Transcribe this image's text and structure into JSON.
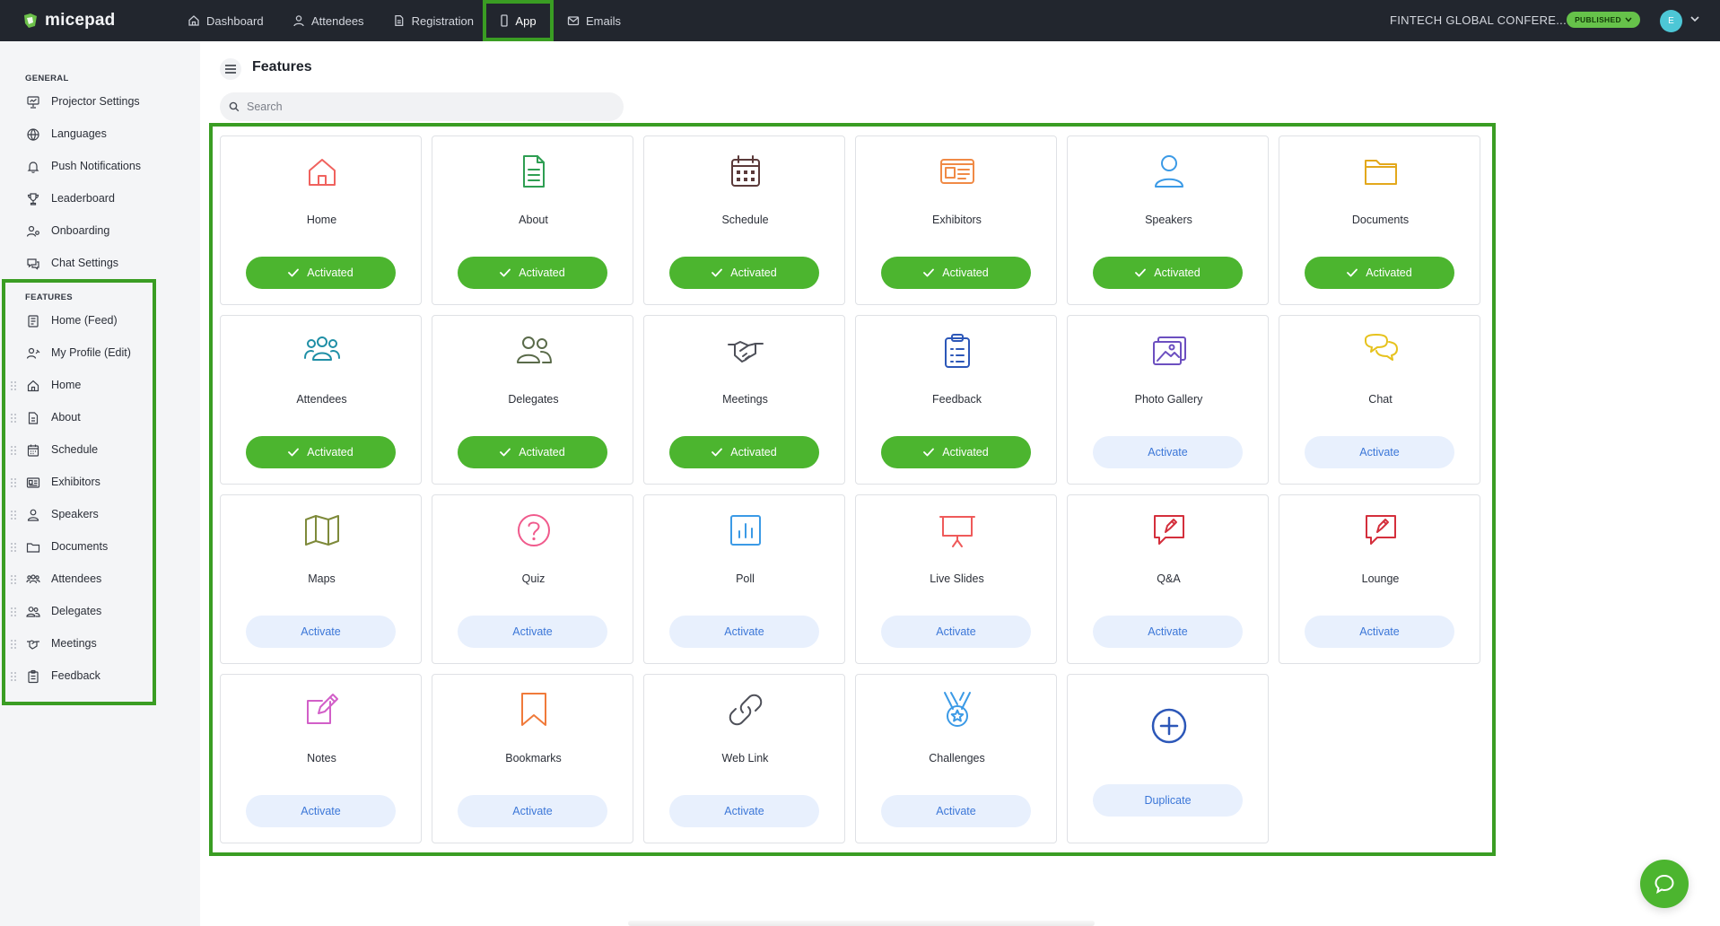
{
  "app": {
    "name": "micepad"
  },
  "nav": {
    "items": [
      {
        "label": "Dashboard",
        "icon": "home-icon"
      },
      {
        "label": "Attendees",
        "icon": "user-icon"
      },
      {
        "label": "Registration",
        "icon": "document-icon"
      },
      {
        "label": "App",
        "icon": "mobile-icon",
        "active": true
      },
      {
        "label": "Emails",
        "icon": "mail-icon"
      }
    ],
    "event_title": "FINTECH GLOBAL CONFERE...",
    "status": "PUBLISHED",
    "avatar_initial": "E"
  },
  "sidebar": {
    "general_title": "GENERAL",
    "general_items": [
      {
        "label": "Projector Settings",
        "icon": "projector-icon"
      },
      {
        "label": "Languages",
        "icon": "globe-icon"
      },
      {
        "label": "Push Notifications",
        "icon": "bell-icon"
      },
      {
        "label": "Leaderboard",
        "icon": "trophy-icon"
      },
      {
        "label": "Onboarding",
        "icon": "user-settings-icon"
      },
      {
        "label": "Chat Settings",
        "icon": "chat-icon"
      }
    ],
    "features_title": "FEATURES",
    "feature_items": [
      {
        "label": "Home (Feed)",
        "icon": "feed-icon",
        "draggable": false
      },
      {
        "label": "My Profile (Edit)",
        "icon": "profile-edit-icon",
        "draggable": false
      },
      {
        "label": "Home",
        "icon": "home-icon",
        "draggable": true
      },
      {
        "label": "About",
        "icon": "document-icon",
        "draggable": true
      },
      {
        "label": "Schedule",
        "icon": "calendar-icon",
        "draggable": true
      },
      {
        "label": "Exhibitors",
        "icon": "id-card-icon",
        "draggable": true
      },
      {
        "label": "Speakers",
        "icon": "user-icon",
        "draggable": true
      },
      {
        "label": "Documents",
        "icon": "folder-icon",
        "draggable": true
      },
      {
        "label": "Attendees",
        "icon": "group-icon",
        "draggable": true
      },
      {
        "label": "Delegates",
        "icon": "delegates-icon",
        "draggable": true
      },
      {
        "label": "Meetings",
        "icon": "handshake-icon",
        "draggable": true
      },
      {
        "label": "Feedback",
        "icon": "clipboard-icon",
        "draggable": true
      }
    ]
  },
  "main": {
    "title": "Features",
    "search_placeholder": "Search",
    "activated_label": "Activated",
    "activate_label": "Activate",
    "duplicate_label": "Duplicate",
    "features": [
      {
        "label": "Home",
        "icon": "home-icon",
        "color": "#f0625e",
        "status": "activated"
      },
      {
        "label": "About",
        "icon": "document-icon",
        "color": "#2e9e52",
        "status": "activated"
      },
      {
        "label": "Schedule",
        "icon": "calendar-icon",
        "color": "#5b3a3a",
        "status": "activated"
      },
      {
        "label": "Exhibitors",
        "icon": "id-card-icon",
        "color": "#f08a46",
        "status": "activated"
      },
      {
        "label": "Speakers",
        "icon": "user-icon",
        "color": "#3b9ae6",
        "status": "activated"
      },
      {
        "label": "Documents",
        "icon": "folder-icon",
        "color": "#e3a81c",
        "status": "activated"
      },
      {
        "label": "Attendees",
        "icon": "group-icon",
        "color": "#1f8fa6",
        "status": "activated"
      },
      {
        "label": "Delegates",
        "icon": "delegates-icon",
        "color": "#5a6b4a",
        "status": "activated"
      },
      {
        "label": "Meetings",
        "icon": "handshake-icon",
        "color": "#4e5059",
        "status": "activated"
      },
      {
        "label": "Feedback",
        "icon": "clipboard-icon",
        "color": "#2c57b8",
        "status": "activated"
      },
      {
        "label": "Photo Gallery",
        "icon": "gallery-icon",
        "color": "#6c4fc0",
        "status": "inactive"
      },
      {
        "label": "Chat",
        "icon": "chat-icon",
        "color": "#e6c21d",
        "status": "inactive"
      },
      {
        "label": "Maps",
        "icon": "map-icon",
        "color": "#7e8a3a",
        "status": "inactive"
      },
      {
        "label": "Quiz",
        "icon": "question-icon",
        "color": "#f05a8c",
        "status": "inactive"
      },
      {
        "label": "Poll",
        "icon": "poll-icon",
        "color": "#3b9ae6",
        "status": "inactive"
      },
      {
        "label": "Live Slides",
        "icon": "presentation-icon",
        "color": "#ef5a5a",
        "status": "inactive"
      },
      {
        "label": "Q&A",
        "icon": "qa-icon",
        "color": "#d42f3c",
        "status": "inactive"
      },
      {
        "label": "Lounge",
        "icon": "lounge-icon",
        "color": "#d42f3c",
        "status": "inactive"
      },
      {
        "label": "Notes",
        "icon": "notes-icon",
        "color": "#d25fc8",
        "status": "inactive"
      },
      {
        "label": "Bookmarks",
        "icon": "bookmark-icon",
        "color": "#f07a3a",
        "status": "inactive"
      },
      {
        "label": "Web Link",
        "icon": "link-icon",
        "color": "#4e5059",
        "status": "inactive"
      },
      {
        "label": "Challenges",
        "icon": "medal-icon",
        "color": "#3b9ae6",
        "status": "inactive"
      }
    ],
    "duplicate_icon": "plus-circle-icon",
    "duplicate_icon_color": "#2c57b8"
  },
  "colors": {
    "accent_green": "#4cb52f",
    "highlight_green": "#3a9d23",
    "activate_blue": "#3c77d8",
    "topbar": "#22262e"
  },
  "help": {
    "icon": "chat-bubble-icon"
  }
}
